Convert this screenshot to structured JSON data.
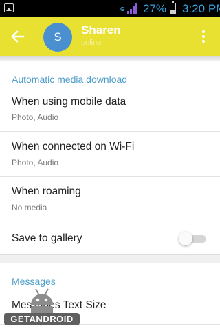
{
  "status_bar": {
    "network": "G",
    "battery_text": "27%",
    "battery_level": 0.27,
    "time": "3:20",
    "time_suffix": "PM"
  },
  "app_bar": {
    "back_icon": "arrow-back-icon",
    "avatar_initial": "S",
    "avatar_color": "#4a90d0",
    "name": "Sharen",
    "status": "online",
    "menu_icon": "more-vert-icon",
    "background": "#e8e132"
  },
  "auto_download": {
    "header": "Automatic media download",
    "header_color": "#4f9ec9",
    "items": [
      {
        "title": "When using mobile data",
        "subtitle": "Photo, Audio"
      },
      {
        "title": "When connected on Wi-Fi",
        "subtitle": "Photo, Audio"
      },
      {
        "title": "When roaming",
        "subtitle": "No media"
      }
    ],
    "save_to_gallery": {
      "title": "Save to gallery",
      "enabled": false
    }
  },
  "messages": {
    "header": "Messages",
    "items": [
      {
        "title": "Messages Text Size"
      }
    ]
  },
  "watermark": {
    "text": "GETANDROID"
  }
}
